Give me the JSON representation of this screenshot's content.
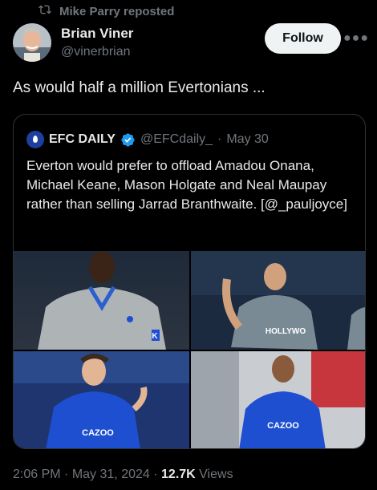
{
  "repost": {
    "text": "Mike Parry reposted",
    "icon": "repost-icon"
  },
  "author": {
    "name": "Brian Viner",
    "handle": "@vinerbrian"
  },
  "follow_label": "Follow",
  "more_icon": "more-icon",
  "tweet_text": "As would half a million Evertonians ...",
  "quote": {
    "name": "EFC DAILY",
    "handle": "@EFCdaily_",
    "separator": "·",
    "date": "May 30",
    "body": "Everton would prefer to offload Amadou Onana, Michael Keane, Mason Holgate and Neal Maupay rather than selling Jarrad Branthwaite. [@_pauljoyce]",
    "photo_texts": {
      "sponsor": "CAZOO",
      "shirt": "HOLLYWO",
      "sleeve": "K"
    }
  },
  "footer": {
    "time": "2:06 PM",
    "sep1": "·",
    "date": "May 31, 2024",
    "sep2": "·",
    "views_count": "12.7K",
    "views_label": "Views"
  },
  "colors": {
    "verified": "#1d9bf0",
    "everton_blue": "#1f4fd1",
    "bg": "#000000"
  }
}
